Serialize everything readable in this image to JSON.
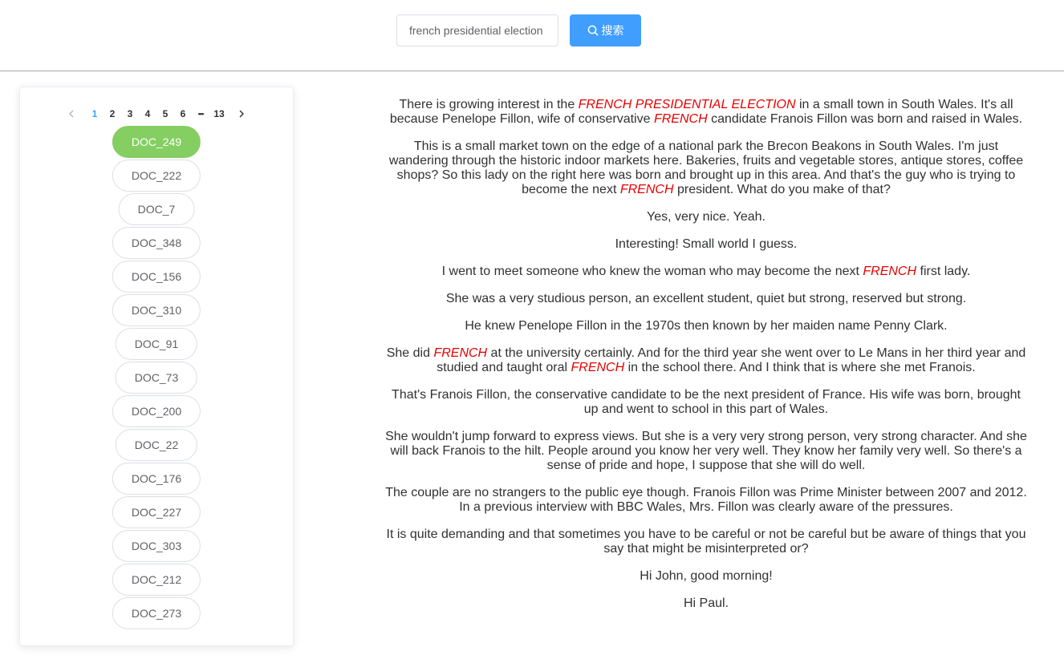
{
  "search": {
    "query": "french presidential election",
    "button_label": "搜索"
  },
  "pagination": {
    "current": 1,
    "pages": [
      "1",
      "2",
      "3",
      "4",
      "5",
      "6"
    ],
    "ellipsis": "•••",
    "last": "13"
  },
  "documents": [
    {
      "label": "DOC_249",
      "active": true
    },
    {
      "label": "DOC_222",
      "active": false
    },
    {
      "label": "DOC_7",
      "active": false
    },
    {
      "label": "DOC_348",
      "active": false
    },
    {
      "label": "DOC_156",
      "active": false
    },
    {
      "label": "DOC_310",
      "active": false
    },
    {
      "label": "DOC_91",
      "active": false
    },
    {
      "label": "DOC_73",
      "active": false
    },
    {
      "label": "DOC_200",
      "active": false
    },
    {
      "label": "DOC_22",
      "active": false
    },
    {
      "label": "DOC_176",
      "active": false
    },
    {
      "label": "DOC_227",
      "active": false
    },
    {
      "label": "DOC_303",
      "active": false
    },
    {
      "label": "DOC_212",
      "active": false
    },
    {
      "label": "DOC_273",
      "active": false
    }
  ],
  "article": {
    "paragraphs": [
      [
        {
          "t": "There is growing interest in the "
        },
        {
          "t": "FRENCH PRESIDENTIAL ELECTION",
          "hl": true
        },
        {
          "t": " in a small town in South Wales. It's all because Penelope Fillon, wife of conservative "
        },
        {
          "t": "FRENCH",
          "hl": true
        },
        {
          "t": " candidate Franois Fillon was born and raised in Wales."
        }
      ],
      [
        {
          "t": "This is a small market town on the edge of a national park the Brecon Beakons in South Wales. I'm just wandering through the historic indoor markets here. Bakeries, fruits and vegetable stores, antique stores, coffee shops? So this lady on the right here was born and brought up in this area. And that's the guy who is trying to become the next "
        },
        {
          "t": "FRENCH",
          "hl": true
        },
        {
          "t": " president. What do you make of that?"
        }
      ],
      [
        {
          "t": "Yes, very nice. Yeah."
        }
      ],
      [
        {
          "t": "Interesting! Small world I guess."
        }
      ],
      [
        {
          "t": "I went to meet someone who knew the woman who may become the next "
        },
        {
          "t": "FRENCH",
          "hl": true
        },
        {
          "t": " first lady."
        }
      ],
      [
        {
          "t": "She was a very studious person, an excellent student, quiet but strong, reserved but strong."
        }
      ],
      [
        {
          "t": "He knew Penelope Fillon in the 1970s then known by her maiden name Penny Clark."
        }
      ],
      [
        {
          "t": "She did "
        },
        {
          "t": "FRENCH",
          "hl": true
        },
        {
          "t": " at the university certainly. And for the third year she went over to Le Mans in her third year and studied and taught oral "
        },
        {
          "t": "FRENCH",
          "hl": true
        },
        {
          "t": " in the school there. And I think that is where she met Franois."
        }
      ],
      [
        {
          "t": "That's Franois Fillon, the conservative candidate to be the next president of France. His wife was born, brought up and went to school in this part of Wales."
        }
      ],
      [
        {
          "t": "She wouldn't jump forward to express views. But she is a very very strong person, very strong character. And she will back Franois to the hilt. People around you know her very well. They know her family very well. So there's a sense of pride and hope, I suppose that she will do well."
        }
      ],
      [
        {
          "t": "The couple are no strangers to the public eye though. Franois Fillon was Prime Minister between 2007 and 2012. In a previous interview with BBC Wales, Mrs. Fillon was clearly aware of the pressures."
        }
      ],
      [
        {
          "t": "It is quite demanding and that sometimes you have to be careful or not be careful but be aware of things that you say that might be misinterpreted or?"
        }
      ],
      [
        {
          "t": "Hi John, good morning!"
        }
      ],
      [
        {
          "t": "Hi Paul."
        }
      ]
    ]
  },
  "colors": {
    "primary": "#409eff",
    "active_doc": "#85ce61",
    "highlight": "#e60000"
  }
}
